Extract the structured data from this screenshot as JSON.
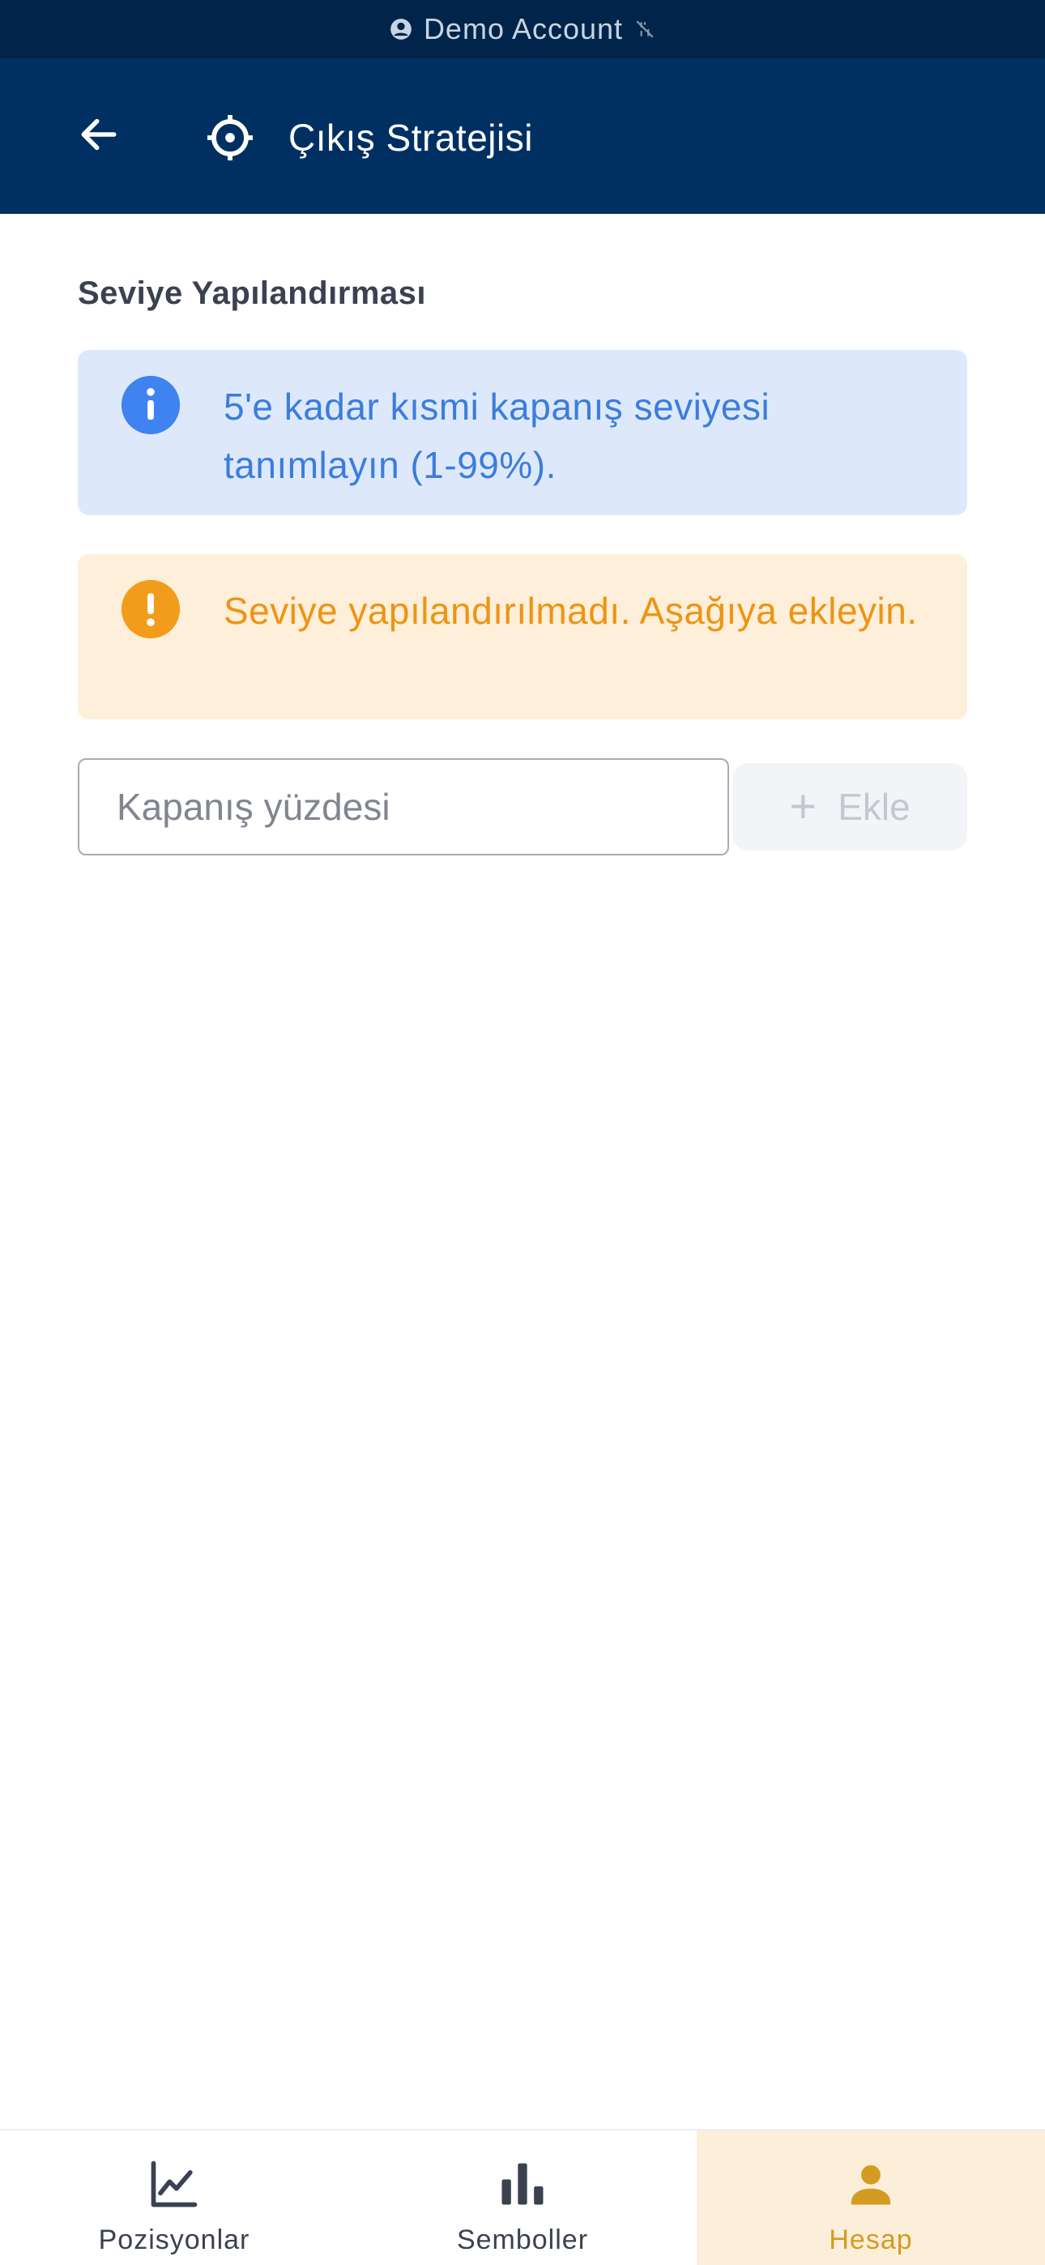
{
  "status_banner": {
    "label": "Demo Account",
    "icon": "account-circle-icon",
    "secondary_icon": "signal-off-icon"
  },
  "app_bar": {
    "back_icon": "back-arrow-icon",
    "title_icon": "crosshair-icon",
    "title": "Çıkış Stratejisi"
  },
  "section": {
    "title": "Seviye Yapılandırması"
  },
  "info_alert": {
    "icon": "info-icon",
    "text": "5'e kadar kısmi kapanış seviyesi tanımlayın (1-99%)."
  },
  "warning_alert": {
    "icon": "exclamation-icon",
    "text": "Seviye yapılandırılmadı. Aşağıya ekleyin."
  },
  "level_input": {
    "placeholder": "Kapanış yüzdesi",
    "value": ""
  },
  "add_button": {
    "label": "Ekle",
    "icon": "plus-icon"
  },
  "bottom_nav": {
    "items": [
      {
        "label": "Pozisyonlar",
        "icon": "line-chart-icon",
        "active": false
      },
      {
        "label": "Semboller",
        "icon": "bar-chart-icon",
        "active": false
      },
      {
        "label": "Hesap",
        "icon": "person-icon",
        "active": true
      }
    ]
  },
  "colors": {
    "banner_bg": "#01244a",
    "app_bar_bg": "#003062",
    "info_bg": "#dde9fb",
    "info_accent": "#3f83f0",
    "warning_bg": "#fdefd9",
    "warning_accent": "#f29c1c",
    "nav_active_bg": "#fbefd9",
    "nav_active_text": "#d49b22"
  }
}
